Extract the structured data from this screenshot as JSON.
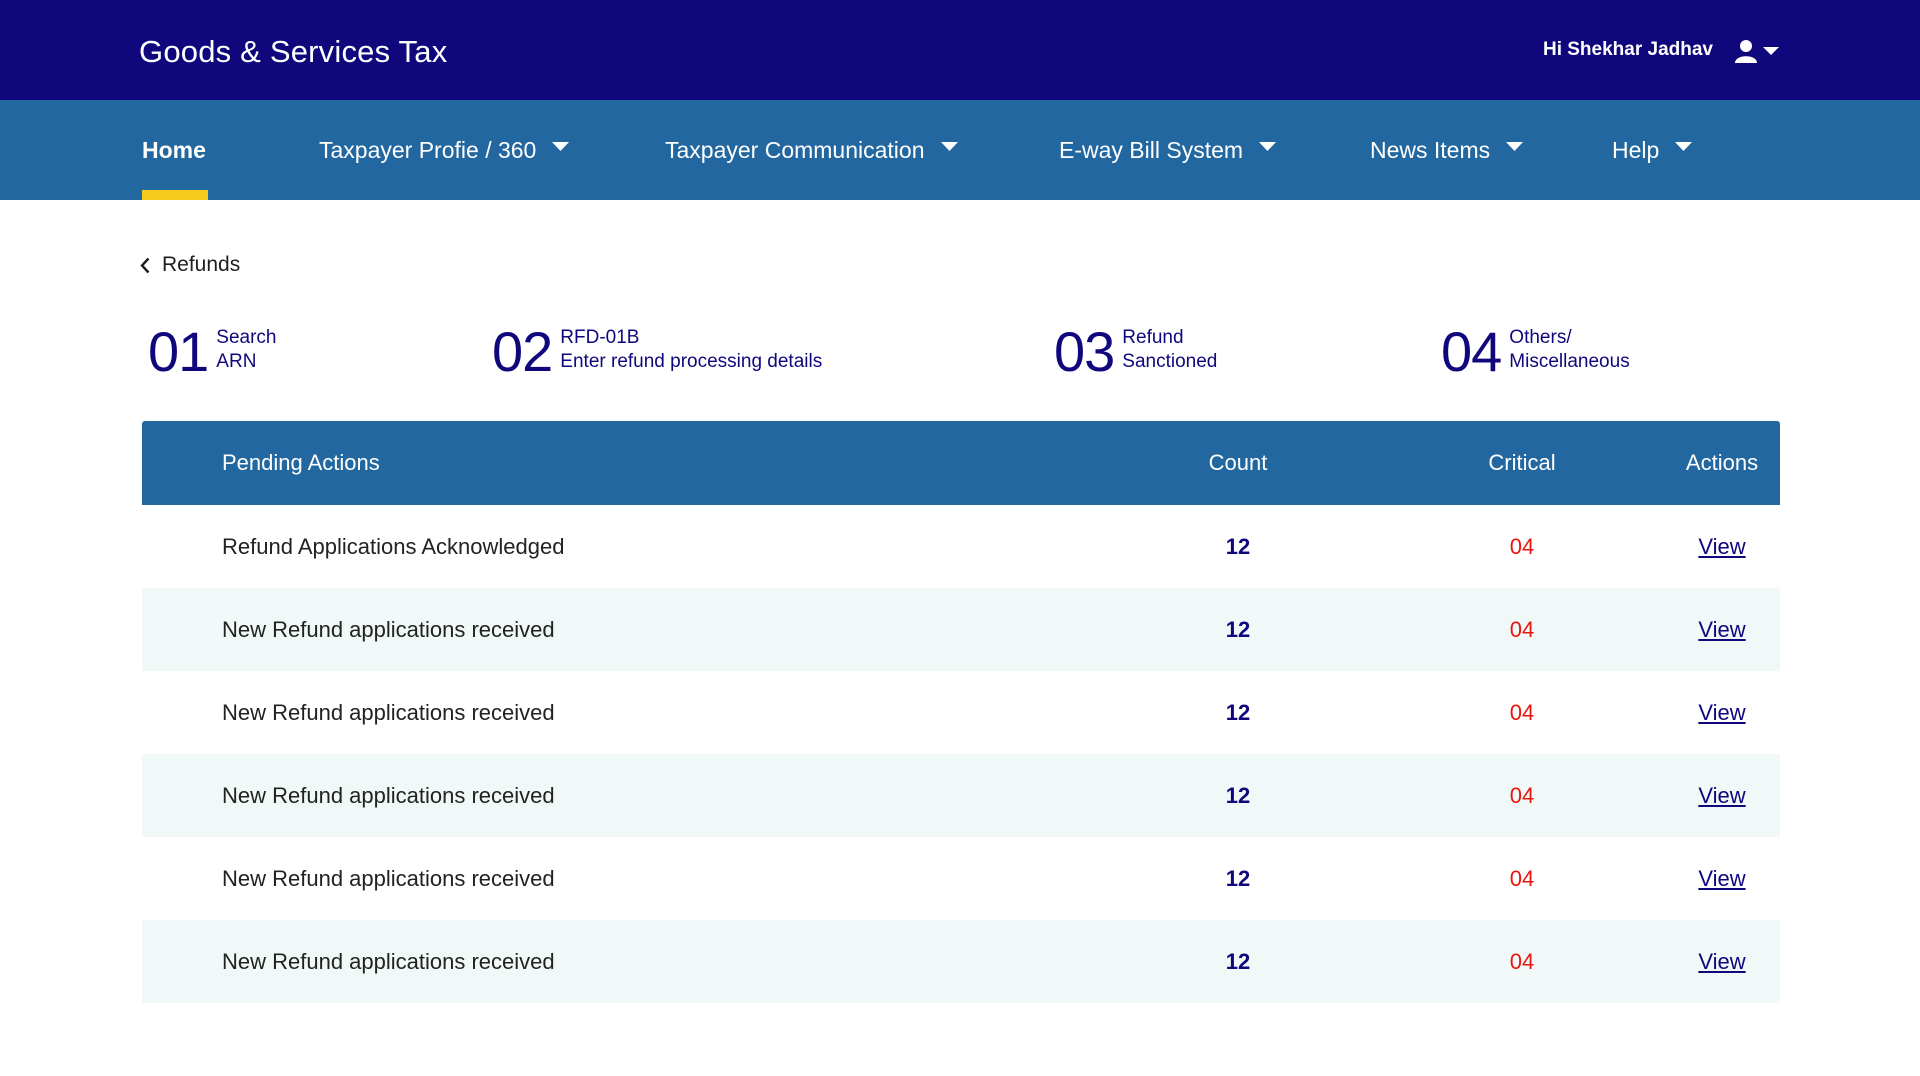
{
  "header": {
    "title": "Goods & Services Tax",
    "greeting": "Hi Shekhar Jadhav",
    "icons": [
      "user-icon",
      "chevron-down-icon"
    ]
  },
  "nav": {
    "items": [
      {
        "label": "Home",
        "active": true
      },
      {
        "label": "Taxpayer Profie / 360",
        "dropdown": true
      },
      {
        "label": "Taxpayer Communication",
        "dropdown": true
      },
      {
        "label": "E-way Bill System",
        "dropdown": true
      },
      {
        "label": "News Items",
        "dropdown": true
      },
      {
        "label": "Help",
        "dropdown": true
      }
    ]
  },
  "breadcrumb": {
    "label": "Refunds",
    "icon": "chevron-left-icon"
  },
  "steps": [
    {
      "num": "01",
      "line1": "Search",
      "line2": "ARN"
    },
    {
      "num": "02",
      "line1": "RFD-01B",
      "line2": "Enter refund processing details"
    },
    {
      "num": "03",
      "line1": "Refund",
      "line2": "Sanctioned"
    },
    {
      "num": "04",
      "line1": "Others/",
      "line2": "Miscellaneous"
    }
  ],
  "table": {
    "columns": [
      "Pending Actions",
      "Count",
      "Critical",
      "Actions"
    ],
    "rows": [
      {
        "action": "Refund Applications Acknowledged",
        "count": "12",
        "critical": "04",
        "link": "View"
      },
      {
        "action": "New Refund applications received",
        "count": "12",
        "critical": "04",
        "link": "View"
      },
      {
        "action": "New Refund applications received",
        "count": "12",
        "critical": "04",
        "link": "View"
      },
      {
        "action": "New Refund applications received",
        "count": "12",
        "critical": "04",
        "link": "View"
      },
      {
        "action": "New Refund applications received",
        "count": "12",
        "critical": "04",
        "link": "View"
      },
      {
        "action": "New Refund applications received",
        "count": "12",
        "critical": "04",
        "link": "View"
      }
    ]
  },
  "colors": {
    "brand_dark": "#10077d",
    "nav_blue": "#22679f",
    "active_indicator": "#f5cc1d",
    "critical": "#e8170f",
    "alt_row": "#f1f9f8"
  }
}
